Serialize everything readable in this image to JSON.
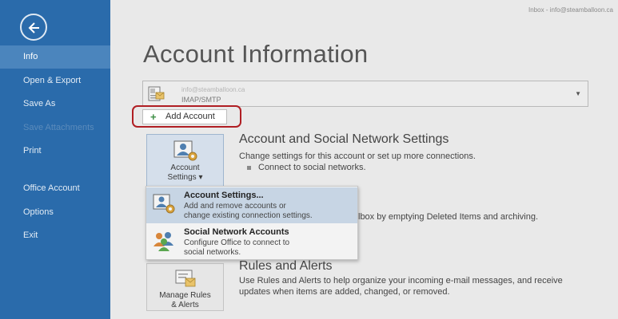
{
  "window_title": "Inbox - info@steamballoon.ca",
  "sidebar": {
    "back_label": "back",
    "items": [
      {
        "label": "Info",
        "state": "active"
      },
      {
        "label": "Open & Export",
        "state": "normal"
      },
      {
        "label": "Save As",
        "state": "normal"
      },
      {
        "label": "Save Attachments",
        "state": "disabled"
      },
      {
        "label": "Print",
        "state": "normal"
      },
      {
        "label": "Office Account",
        "state": "normal"
      },
      {
        "label": "Options",
        "state": "normal"
      },
      {
        "label": "Exit",
        "state": "normal"
      }
    ]
  },
  "page_title": "Account Information",
  "account_selector": {
    "email": "info@steamballoon.ca",
    "type": "IMAP/SMTP"
  },
  "add_account": {
    "label": "Add Account"
  },
  "account_settings_tile": {
    "line1": "Account",
    "line2": "Settings ▾"
  },
  "account_section": {
    "title": "Account and Social Network Settings",
    "desc": "Change settings for this account or set up more connections.",
    "bullet": "Connect to social networks."
  },
  "partial_text": "lbox by emptying Deleted Items and archiving.",
  "menu": {
    "items": [
      {
        "title": "Account Settings...",
        "desc1": "Add and remove accounts or",
        "desc2": "change existing connection settings."
      },
      {
        "title": "Social Network Accounts",
        "desc1": "Configure Office to connect to",
        "desc2": "social networks."
      }
    ]
  },
  "rules_tile": {
    "line1": "Manage Rules",
    "line2": "& Alerts"
  },
  "rules_section": {
    "title": "Rules and Alerts",
    "desc1": "Use Rules and Alerts to help organize your incoming e-mail messages, and receive",
    "desc2": "updates when items are added, changed, or removed."
  },
  "colors": {
    "sidebar": "#2a6bab",
    "active_nav": "#4b85bd",
    "highlight_ring": "#b01e23",
    "menu_hover": "#c7d5e4"
  }
}
